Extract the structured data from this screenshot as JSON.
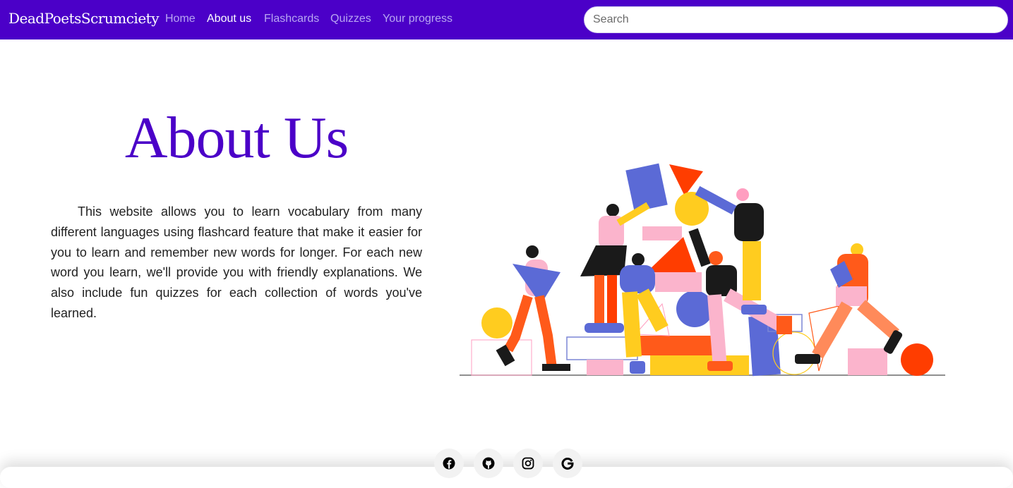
{
  "nav": {
    "brand": "DeadPoetsScrumciety",
    "links": [
      {
        "label": "Home",
        "active": false
      },
      {
        "label": "About us",
        "active": true
      },
      {
        "label": "Flashcards",
        "active": false
      },
      {
        "label": "Quizzes",
        "active": false
      },
      {
        "label": "Your progress",
        "active": false
      }
    ],
    "search_placeholder": "Search"
  },
  "main": {
    "title": "About Us",
    "body": "This website allows you to learn vocabulary from many different languages using flashcard feature that make it easier for you to learn and remember new words for longer. For each new word you learn, we'll provide you with friendly explanations. We also include fun quizzes for each collection of words you've learned."
  },
  "footer": {
    "social_icons": [
      "facebook-icon",
      "github-icon",
      "instagram-icon",
      "google-icon"
    ]
  },
  "colors": {
    "brand": "#4b00c8",
    "nav_link": "#b9a6f2",
    "nav_link_active": "#ffffff",
    "text": "#222222"
  }
}
